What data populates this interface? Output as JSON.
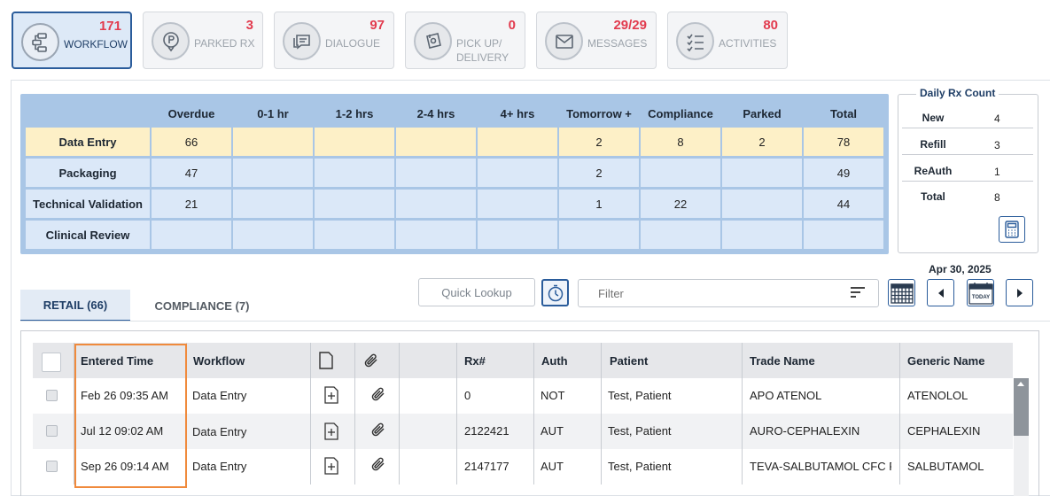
{
  "tiles": [
    {
      "count": "171",
      "label": "WORKFLOW",
      "icon": "workflow-icon"
    },
    {
      "count": "3",
      "label": "PARKED RX",
      "icon": "parked-rx-icon"
    },
    {
      "count": "97",
      "label": "DIALOGUE",
      "icon": "dialogue-icon"
    },
    {
      "count": "0",
      "label_line1": "PICK UP/",
      "label_line2": "DELIVERY",
      "icon": "pickup-delivery-icon"
    },
    {
      "count": "29/29",
      "label": "MESSAGES",
      "icon": "messages-icon"
    },
    {
      "count": "80",
      "label": "ACTIVITIES",
      "icon": "activities-icon"
    }
  ],
  "grid": {
    "columns": [
      "Overdue",
      "0-1 hr",
      "1-2 hrs",
      "2-4 hrs",
      "4+ hrs",
      "Tomorrow +",
      "Compliance",
      "Parked",
      "Total"
    ],
    "rows": [
      {
        "label": "Data Entry",
        "cells": [
          "66",
          "",
          "",
          "",
          "",
          "2",
          "8",
          "2",
          "78"
        ]
      },
      {
        "label": "Packaging",
        "cells": [
          "47",
          "",
          "",
          "",
          "",
          "2",
          "",
          "",
          "49"
        ]
      },
      {
        "label": "Technical Validation",
        "cells": [
          "21",
          "",
          "",
          "",
          "",
          "1",
          "22",
          "",
          "44"
        ]
      },
      {
        "label": "Clinical Review",
        "cells": [
          "",
          "",
          "",
          "",
          "",
          "",
          "",
          "",
          ""
        ]
      }
    ]
  },
  "daily": {
    "title": "Daily Rx Count",
    "rows": [
      {
        "k": "New",
        "v": "4"
      },
      {
        "k": "Refill",
        "v": "3"
      },
      {
        "k": "ReAuth",
        "v": "1"
      },
      {
        "k": "Total",
        "v": "8"
      }
    ]
  },
  "tabs": {
    "retail": "RETAIL (66)",
    "compliance": "COMPLIANCE (7)"
  },
  "toolbar": {
    "quick_lookup": "Quick Lookup",
    "filter_placeholder": "Filter",
    "date": "Apr 30, 2025"
  },
  "rx_table": {
    "headers": [
      "Entered Time",
      "Workflow",
      "",
      "",
      "",
      "Rx#",
      "Auth",
      "Patient",
      "Trade Name",
      "Generic Name"
    ],
    "rows": [
      {
        "entered": "Feb 26 09:35 AM",
        "workflow": "Data Entry",
        "rx": "0",
        "auth": "NOT",
        "patient": "Test, Patient",
        "trade": "APO ATENOL",
        "generic": "ATENOLOL"
      },
      {
        "entered": "Jul 12 09:02 AM",
        "workflow": "Data Entry",
        "rx": "2122421",
        "auth": "AUT",
        "patient": "Test, Patient",
        "trade": "AURO-CEPHALEXIN",
        "generic": "CEPHALEXIN"
      },
      {
        "entered": "Sep 26 09:14 AM",
        "workflow": "Data Entry",
        "rx": "2147177",
        "auth": "AUT",
        "patient": "Test, Patient",
        "trade": "TEVA-SALBUTAMOL CFC F",
        "generic": "SALBUTAMOL"
      }
    ]
  },
  "colors": {
    "accent": "#2a5c9b",
    "count": "#e23b4e",
    "highlight_row": "#fdf0c7",
    "grid_bg": "#a9c6e6",
    "focus_box": "#f08a3c"
  }
}
